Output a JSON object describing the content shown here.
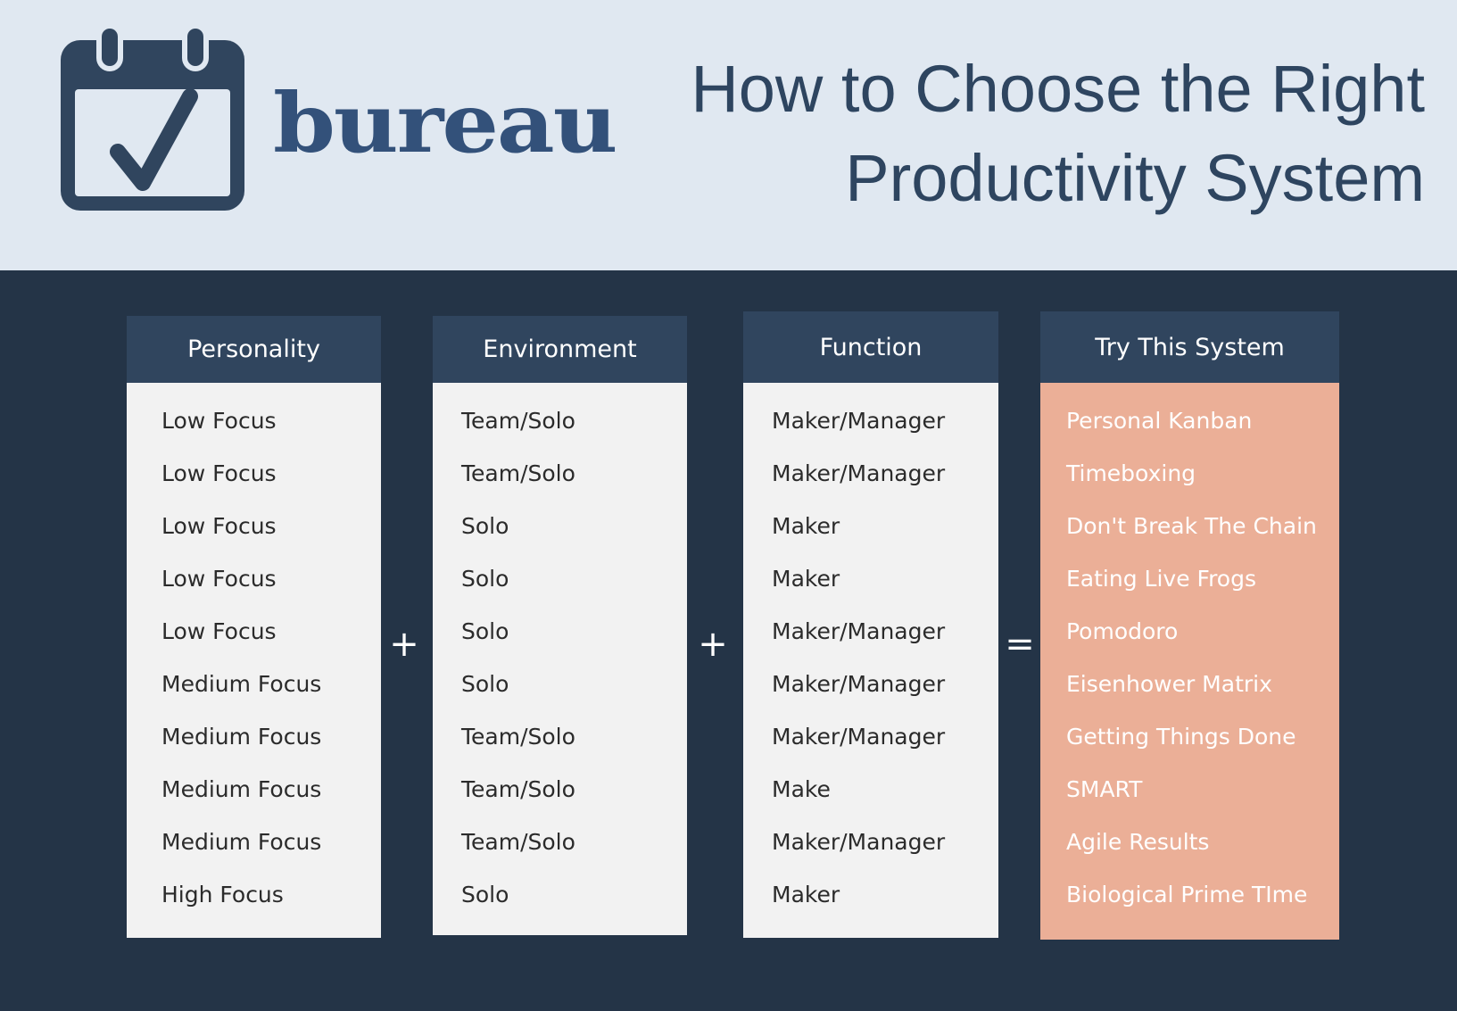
{
  "header": {
    "brand": "bureau",
    "logo_icon": "calendar-check-icon",
    "title_line1": "How to Choose the Right",
    "title_line2": "Productivity System"
  },
  "colors": {
    "header_bg": "#e0e8f1",
    "main_bg": "#243447",
    "column_header_bg": "#30455e",
    "column_body_bg": "#f2f2f2",
    "accent": "#ebaf97",
    "brand": "#33517a",
    "title": "#2e4560"
  },
  "operators": {
    "plus1": "+",
    "plus2": "+",
    "equals": "="
  },
  "columns": [
    {
      "header": "Personality",
      "items": [
        "Low Focus",
        "Low Focus",
        "Low Focus",
        "Low Focus",
        "Low Focus",
        "Medium Focus",
        "Medium Focus",
        "Medium Focus",
        "Medium Focus",
        "High Focus"
      ]
    },
    {
      "header": "Environment",
      "items": [
        "Team/Solo",
        "Team/Solo",
        "Solo",
        "Solo",
        "Solo",
        "Solo",
        "Team/Solo",
        "Team/Solo",
        "Team/Solo",
        "Solo"
      ]
    },
    {
      "header": "Function",
      "items": [
        "Maker/Manager",
        "Maker/Manager",
        "Maker",
        "Maker",
        "Maker/Manager",
        "Maker/Manager",
        "Maker/Manager",
        "Make",
        "Maker/Manager",
        "Maker"
      ]
    },
    {
      "header": "Try This System",
      "items": [
        "Personal Kanban",
        "Timeboxing",
        "Don't Break The Chain",
        "Eating Live Frogs",
        "Pomodoro",
        "Eisenhower Matrix",
        "Getting Things Done",
        "SMART",
        "Agile Results",
        "Biological Prime TIme"
      ]
    }
  ]
}
